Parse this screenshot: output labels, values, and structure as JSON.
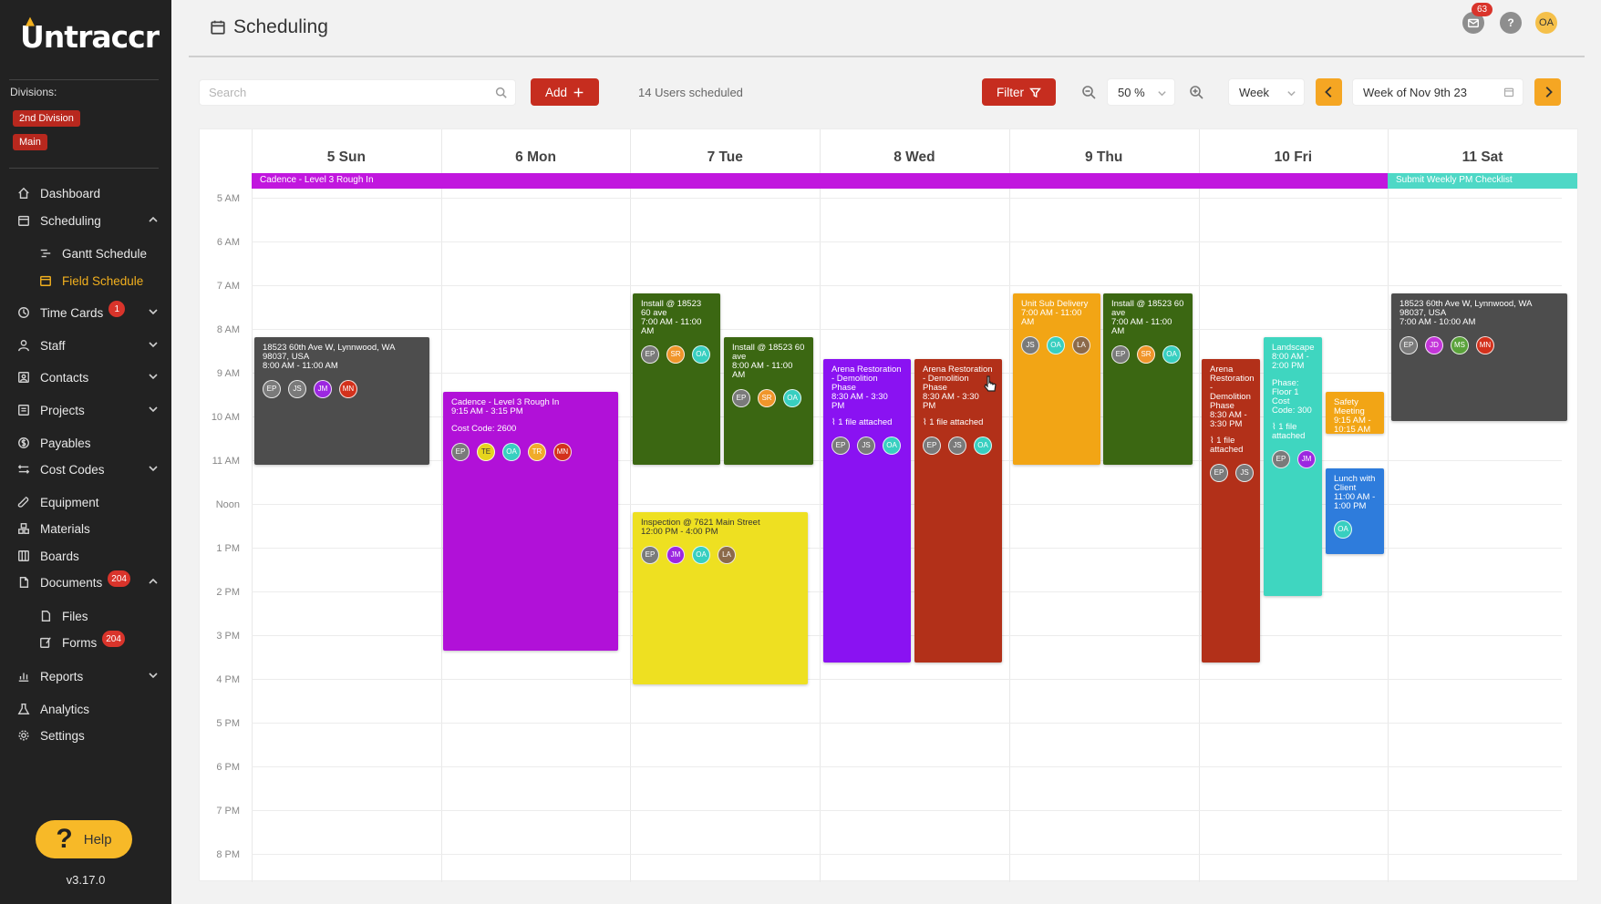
{
  "app": {
    "logo_text": "Untraccr",
    "version": "v3.17.0",
    "help_label": "Help"
  },
  "sidebar": {
    "divisions_label": "Divisions:",
    "divisions": [
      "2nd Division",
      "Main"
    ],
    "items": [
      {
        "label": "Dashboard",
        "icon": "home-icon"
      },
      {
        "label": "Scheduling",
        "icon": "calendar-icon",
        "expanded": true
      },
      {
        "label": "Gantt Schedule",
        "icon": "gantt-icon",
        "sub": true
      },
      {
        "label": "Field Schedule",
        "icon": "calendar-icon",
        "sub": true,
        "active": true
      },
      {
        "label": "Time Cards",
        "icon": "clock-icon",
        "badge": "1"
      },
      {
        "label": "Staff",
        "icon": "user-icon"
      },
      {
        "label": "Contacts",
        "icon": "contacts-icon"
      },
      {
        "label": "Projects",
        "icon": "projects-icon"
      },
      {
        "label": "Payables",
        "icon": "dollar-icon"
      },
      {
        "label": "Cost Codes",
        "icon": "swap-icon"
      },
      {
        "label": "Equipment",
        "icon": "wrench-icon"
      },
      {
        "label": "Materials",
        "icon": "materials-icon"
      },
      {
        "label": "Boards",
        "icon": "boards-icon"
      },
      {
        "label": "Documents",
        "icon": "document-icon",
        "badge": "204",
        "expanded": true
      },
      {
        "label": "Files",
        "icon": "file-icon",
        "sub": true
      },
      {
        "label": "Forms",
        "icon": "form-icon",
        "sub": true,
        "badge": "204"
      },
      {
        "label": "Reports",
        "icon": "chart-icon"
      },
      {
        "label": "Analytics",
        "icon": "flask-icon"
      },
      {
        "label": "Settings",
        "icon": "gear-icon"
      }
    ]
  },
  "header": {
    "title": "Scheduling",
    "notification_count": "63",
    "help_icon": "?",
    "user_initials": "OA"
  },
  "toolbar": {
    "search_placeholder": "Search",
    "add_label": "Add",
    "users_scheduled": "14 Users scheduled",
    "filter_label": "Filter",
    "zoom_value": "50 %",
    "view_value": "Week",
    "week_label": "Week of Nov 9th 23"
  },
  "calendar": {
    "days": [
      "5 Sun",
      "6 Mon",
      "7 Tue",
      "8 Wed",
      "9 Thu",
      "10 Fri",
      "11 Sat"
    ],
    "hours": [
      "5 AM",
      "6 AM",
      "7 AM",
      "8 AM",
      "9 AM",
      "10 AM",
      "11 AM",
      "Noon",
      "1 PM",
      "2 PM",
      "3 PM",
      "4 PM",
      "5 PM",
      "6 PM",
      "7 PM",
      "8 PM"
    ],
    "colors": {
      "grey": "#4d4d4d",
      "green": "#3b6712",
      "magenta": "#b111d8",
      "purple": "#8a12f2",
      "red": "#b23019",
      "orange": "#f2a515",
      "yellow": "#eee021",
      "teal": "#3fd6c0",
      "blue": "#2e7cdc",
      "banner_magenta": "#c117de",
      "banner_teal": "#4ed8c6"
    },
    "avatar_colors": {
      "EP": "#7a7a7a",
      "JS": "#7a7a7a",
      "JM": "#9c27e0",
      "MN": "#d3311c",
      "TE": "#e6d41e",
      "OA": "#38cfc0",
      "TR": "#f0ab2a",
      "SR": "#f0952a",
      "LA": "#8c6a4a",
      "JD": "#c335d9",
      "MS": "#5aa23a"
    },
    "banners": [
      {
        "title": "Cadence - Level 3 Rough In",
        "color": "banner_magenta"
      },
      {
        "title": "Submit Weekly PM Checklist",
        "color": "banner_teal"
      }
    ],
    "events": [
      {
        "title": "18523 60th Ave W, Lynnwood, WA 98037, USA",
        "time": "8:00 AM - 11:00 AM",
        "color": "grey",
        "avatars": [
          "EP",
          "JS",
          "JM",
          "MN"
        ]
      },
      {
        "title": "Cadence - Level 3 Rough In",
        "time": "9:15 AM - 3:15 PM",
        "extra": "Cost Code: 2600",
        "color": "magenta",
        "avatars": [
          "EP",
          "TE",
          "OA",
          "TR",
          "MN"
        ]
      },
      {
        "title": "Install @ 18523 60 ave",
        "time": "7:00 AM - 11:00 AM",
        "color": "green",
        "avatars": [
          "EP",
          "SR",
          "OA"
        ]
      },
      {
        "title": "Install @ 18523 60 ave",
        "time": "8:00 AM - 11:00 AM",
        "color": "green",
        "avatars": [
          "EP",
          "SR",
          "OA"
        ]
      },
      {
        "title": "Inspection @ 7621 Main Street",
        "time": "12:00 PM - 4:00 PM",
        "color": "yellow",
        "dark": true,
        "avatars": [
          "EP",
          "JM",
          "OA",
          "LA"
        ]
      },
      {
        "title": "Arena Restoration - Demolition Phase",
        "time": "8:30 AM - 3:30 PM",
        "attach": "1 file attached",
        "color": "purple",
        "avatars": [
          "EP",
          "JS",
          "OA"
        ]
      },
      {
        "title": "Arena Restoration - Demolition Phase",
        "time": "8:30 AM - 3:30 PM",
        "attach": "1 file attached",
        "color": "red",
        "avatars": [
          "EP",
          "JS",
          "OA"
        ]
      },
      {
        "title": "Unit Sub Delivery",
        "time": "7:00 AM - 11:00 AM",
        "color": "orange",
        "avatars": [
          "JS",
          "OA",
          "LA"
        ]
      },
      {
        "title": "Install @ 18523 60 ave",
        "time": "7:00 AM - 11:00 AM",
        "color": "green",
        "avatars": [
          "EP",
          "SR",
          "OA"
        ]
      },
      {
        "title": "Arena Restoration - Demolition Phase",
        "time": "8:30 AM - 3:30 PM",
        "attach": "1 file attached",
        "color": "red",
        "avatars": [
          "EP",
          "JS"
        ]
      },
      {
        "title": "Landscape",
        "time": "8:00 AM - 2:00 PM",
        "extra": "Phase: Floor 1 Cost Code: 300",
        "attach": "1 file attached",
        "color": "teal",
        "avatars": [
          "EP",
          "JM"
        ]
      },
      {
        "title": "Safety Meeting",
        "time": "9:15 AM - 10:15 AM",
        "color": "orange",
        "avatars": []
      },
      {
        "title": "Lunch with Client",
        "time": "11:00 AM - 1:00 PM",
        "color": "blue",
        "avatars": [
          "OA"
        ]
      },
      {
        "title": "18523 60th Ave W, Lynnwood, WA 98037, USA",
        "time": "7:00 AM - 10:00 AM",
        "color": "grey",
        "avatars": [
          "EP",
          "JD",
          "MS",
          "MN"
        ]
      }
    ]
  }
}
